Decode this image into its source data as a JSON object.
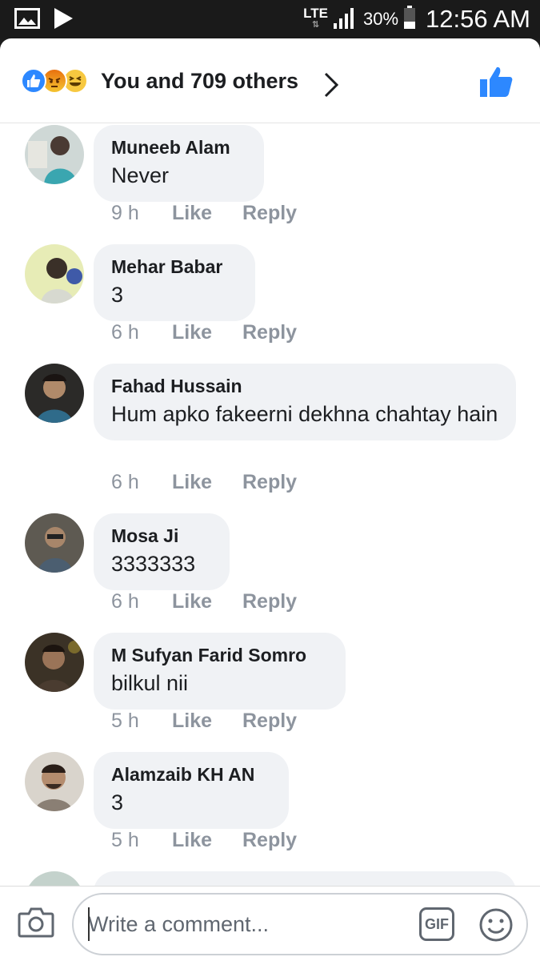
{
  "status_bar": {
    "network": "LTE",
    "battery": "30%",
    "time": "12:56 AM"
  },
  "reactions": {
    "summary": "You and 709 others",
    "icons": [
      "like-reaction-icon",
      "angry-reaction-icon",
      "haha-reaction-icon"
    ]
  },
  "comments": [
    {
      "author": "Muneeb Alam",
      "text": "Never",
      "time": "9 h",
      "like": "Like",
      "reply": "Reply"
    },
    {
      "author": "Mehar Babar",
      "text": "3",
      "time": "6 h",
      "like": "Like",
      "reply": "Reply"
    },
    {
      "author": "Fahad Hussain",
      "text": "Hum apko fakeerni dekhna chahtay hain",
      "time": "6 h",
      "like": "Like",
      "reply": "Reply"
    },
    {
      "author": "Mosa Ji",
      "text": "3333333",
      "time": "6 h",
      "like": "Like",
      "reply": "Reply"
    },
    {
      "author": "M Sufyan Farid Somro",
      "text": "bilkul nii",
      "time": "5 h",
      "like": "Like",
      "reply": "Reply"
    },
    {
      "author": "Alamzaib KH AN",
      "text": "3",
      "time": "5 h",
      "like": "Like",
      "reply": "Reply"
    }
  ],
  "composer": {
    "placeholder": "Write a comment...",
    "gif_label": "GIF"
  },
  "colors": {
    "facebook_blue": "#2d88ff",
    "bubble": "#f0f2f5",
    "meta_gray": "#8d949e"
  }
}
